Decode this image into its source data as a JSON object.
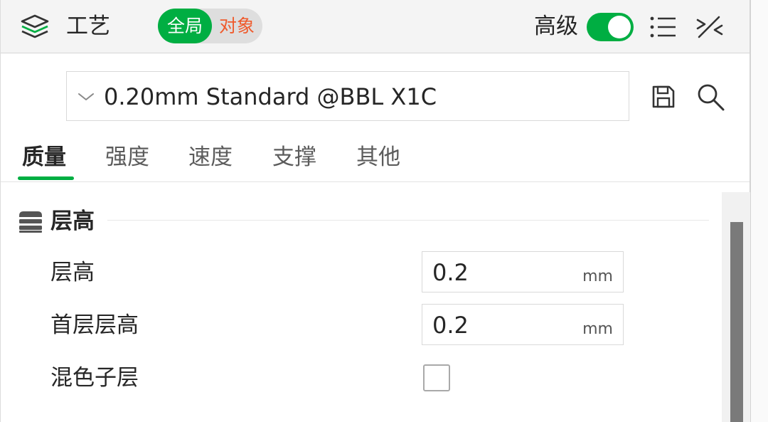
{
  "header": {
    "title": "工艺",
    "scope": {
      "global_label": "全局",
      "object_label": "对象",
      "selected": "全局"
    },
    "advanced": {
      "label": "高级",
      "enabled": true
    },
    "icons": [
      "layers-icon",
      "list-icon",
      "collapse-icon"
    ]
  },
  "preset": {
    "selected": "0.20mm Standard @BBL X1C",
    "icons": [
      "chevron-down-icon",
      "save-icon",
      "search-icon"
    ]
  },
  "tabs": {
    "items": [
      {
        "label": "质量"
      },
      {
        "label": "强度"
      },
      {
        "label": "速度"
      },
      {
        "label": "支撑"
      },
      {
        "label": "其他"
      }
    ],
    "active": "质量"
  },
  "section": {
    "title": "层高",
    "icon": "layer-stack-icon",
    "rows": [
      {
        "label": "层高",
        "value": "0.2",
        "unit": "mm"
      },
      {
        "label": "首层层高",
        "value": "0.2",
        "unit": "mm"
      },
      {
        "label": "混色子层",
        "checked": false
      }
    ]
  },
  "colors": {
    "accent": "#00ae42",
    "object_text": "#ef5a2c",
    "header_bg": "#f4f4f4",
    "scroll_thumb": "#7a7a7a"
  }
}
